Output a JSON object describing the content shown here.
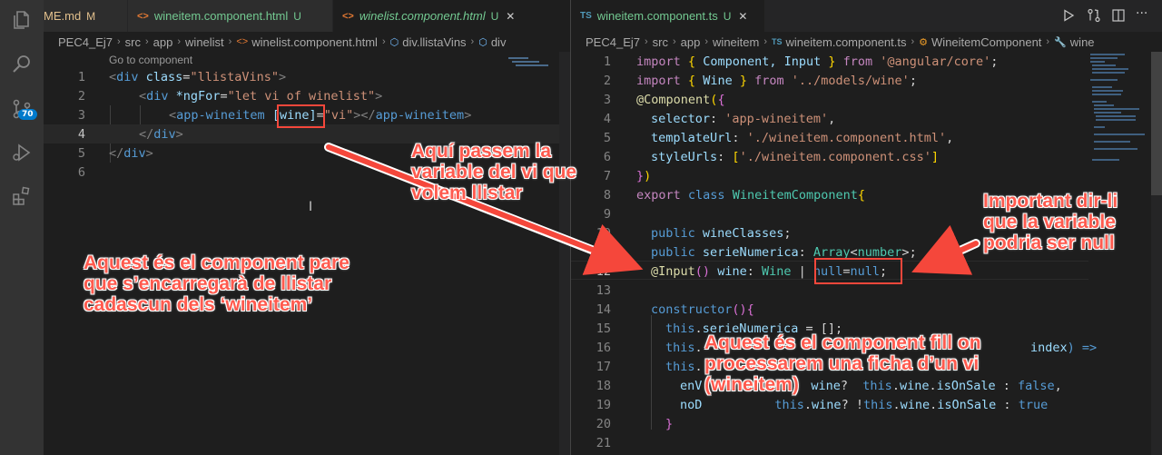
{
  "colors": {
    "accent": "#007acc",
    "annotation": "#ff5a4e",
    "highlight_box": "#f5473b"
  },
  "activity_bar": {
    "icons": [
      "explorer-icon",
      "search-icon",
      "source-control-icon",
      "run-debug-icon",
      "extensions-icon"
    ],
    "source_control_badge": "70"
  },
  "left_editor": {
    "tabs": [
      {
        "label": "ME.md",
        "status": "M",
        "icon": "markdown-icon"
      },
      {
        "label": "wineitem.component.html",
        "status": "U",
        "icon": "html-icon"
      },
      {
        "label": "winelist.component.html",
        "status": "U",
        "icon": "html-icon",
        "active": true
      }
    ],
    "breadcrumb": [
      "PEC4_Ej7",
      "src",
      "app",
      "winelist",
      "winelist.component.html",
      "div.llistaVins",
      "div"
    ],
    "codelens": "Go to component",
    "lines": [
      {
        "n": "1"
      },
      {
        "n": "2"
      },
      {
        "n": "3"
      },
      {
        "n": "4"
      },
      {
        "n": "5"
      },
      {
        "n": "6"
      }
    ],
    "code": {
      "l1": {
        "a": "<div ",
        "b": "class",
        "c": "=",
        "d": "\"llistaVins\"",
        "e": ">"
      },
      "l2": {
        "a": "<div ",
        "b": "*ngFor",
        "c": "=",
        "d": "\"let vi of winelist\"",
        "e": ">"
      },
      "l3": {
        "a": "<app-wineitem ",
        "b": "[wine]",
        "c": "=",
        "d": "\"vi\"",
        "e": "></app-wineitem>"
      },
      "l4": "</div>",
      "l5": "</div>"
    }
  },
  "right_editor": {
    "tab": {
      "label": "wineitem.component.ts",
      "status": "U",
      "icon": "ts-icon"
    },
    "breadcrumb": [
      "PEC4_Ej7",
      "src",
      "app",
      "wineitem",
      "wineitem.component.ts",
      "WineitemComponent",
      "wine"
    ],
    "line_numbers": [
      "1",
      "2",
      "3",
      "4",
      "5",
      "6",
      "7",
      "8",
      "9",
      "10",
      "11",
      "12",
      "13",
      "14",
      "15",
      "16",
      "17",
      "18",
      "19",
      "20",
      "21"
    ],
    "code": {
      "l1": [
        "import",
        " ",
        "{",
        " Component, Input ",
        "}",
        " from ",
        "'@angular/core'",
        ";"
      ],
      "l2": [
        "import",
        " ",
        "{",
        " Wine ",
        "}",
        " from ",
        "'../models/wine'",
        ";"
      ],
      "l3": [
        "@",
        "Component",
        "(",
        "{"
      ],
      "l4": [
        "selector",
        ": ",
        "'app-wineitem'",
        ","
      ],
      "l5": [
        "templateUrl",
        ": ",
        "'./wineitem.component.html'",
        ","
      ],
      "l6": [
        "styleUrls",
        ": ",
        "[",
        "'./wineitem.component.css'",
        "]"
      ],
      "l7": [
        "}",
        ")"
      ],
      "l8": [
        "export",
        " ",
        "class",
        " ",
        "WineitemComponent",
        "{"
      ],
      "l10": [
        "public",
        " ",
        "wineClasses",
        ";"
      ],
      "l11": [
        "public",
        " ",
        "serieNumerica",
        ": ",
        "Array",
        "<",
        "number",
        ">",
        ";"
      ],
      "l12": [
        "@",
        "Input",
        "()",
        " ",
        "wine",
        ": ",
        "Wine",
        " | ",
        "null",
        "=",
        "null",
        ";"
      ],
      "l14": [
        "constructor",
        "()",
        "{"
      ],
      "l15": [
        "this",
        ".",
        "serieNumerica",
        " = ",
        "[];"
      ],
      "l16a": [
        "this",
        "."
      ],
      "l16b": [
        "index",
        ") =>"
      ],
      "l17": [
        "this",
        "."
      ],
      "l18": [
        "enV",
        "",
        "",
        "",
        "wine",
        "?  ",
        "this",
        ".",
        "wine",
        ".",
        "isOnSale",
        " : ",
        "false",
        ","
      ],
      "l19": [
        "noD",
        "",
        "this",
        ".",
        "wine",
        "? !",
        "this",
        ".",
        "wine",
        ".",
        "isOnSale",
        " : ",
        "true"
      ],
      "l20": "}"
    }
  },
  "toolbar_icons": [
    "run-icon",
    "open-changes-icon",
    "split-editor-icon",
    "more-actions-icon"
  ],
  "annotations": {
    "variable_note": "Aquí passem la\nvariable del vi que\nvolem llistar",
    "parent_note": "Aquest és el component pare\nque s’encarregarà de llistar\ncadascun dels ‘wineitem’",
    "null_note": "Important dir-li\nque la variable\npodria ser null",
    "child_note": "Aquest és el component fill on\nprocessarem una ficha d’un vi\n(wineitem)"
  }
}
